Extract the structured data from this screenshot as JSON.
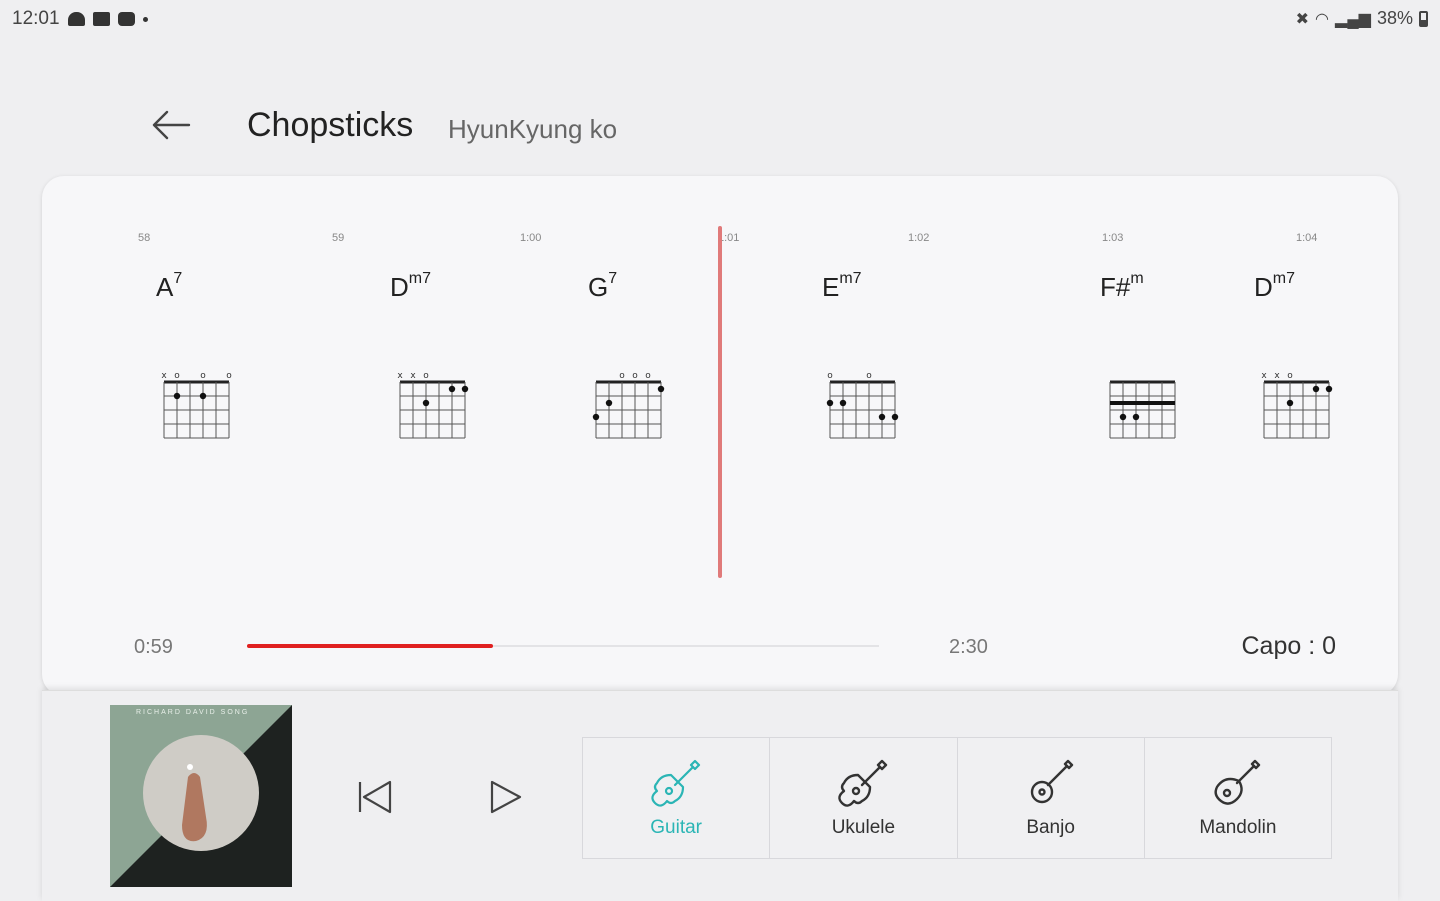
{
  "status_bar": {
    "time": "12:01",
    "battery": "38%",
    "icons_left": [
      "cloud-icon",
      "image-icon",
      "youtube-icon",
      "dot-icon"
    ],
    "icons_right": [
      "mute-icon",
      "wifi-icon",
      "signal-icon",
      "battery-icon"
    ]
  },
  "header": {
    "title": "Chopsticks",
    "artist": "HyunKyung ko"
  },
  "timeline": {
    "marks": [
      "58",
      "59",
      "1:00",
      "1:01",
      "1:02",
      "1:03",
      "1:04"
    ]
  },
  "chords": [
    {
      "root": "A",
      "suffix": "7",
      "strings_top": "x o   o   o"
    },
    {
      "root": "D",
      "suffix": "m7",
      "strings_top": "x x o"
    },
    {
      "root": "G",
      "suffix": "7",
      "strings_top": "o o o"
    },
    {
      "root": "E",
      "suffix": "m7",
      "strings_top": "o     o"
    },
    {
      "root": "F#",
      "suffix": "m",
      "strings_top": ""
    },
    {
      "root": "D",
      "suffix": "m7",
      "strings_top": "x x o"
    }
  ],
  "progress": {
    "elapsed": "0:59",
    "total": "2:30",
    "fraction": 0.39,
    "capo": "Capo : 0"
  },
  "player": {
    "album_art_caption": "RICHARD DAVID SONG",
    "instruments": [
      {
        "label": "Guitar",
        "icon": "guitar-icon",
        "selected": true
      },
      {
        "label": "Ukulele",
        "icon": "ukulele-icon",
        "selected": false
      },
      {
        "label": "Banjo",
        "icon": "banjo-icon",
        "selected": false
      },
      {
        "label": "Mandolin",
        "icon": "mandolin-icon",
        "selected": false
      }
    ]
  },
  "colors": {
    "accent": "#2bb5b5",
    "progress": "#e02020",
    "playhead": "#e07a7a",
    "background": "#efeff1",
    "card": "#f7f7f9"
  }
}
